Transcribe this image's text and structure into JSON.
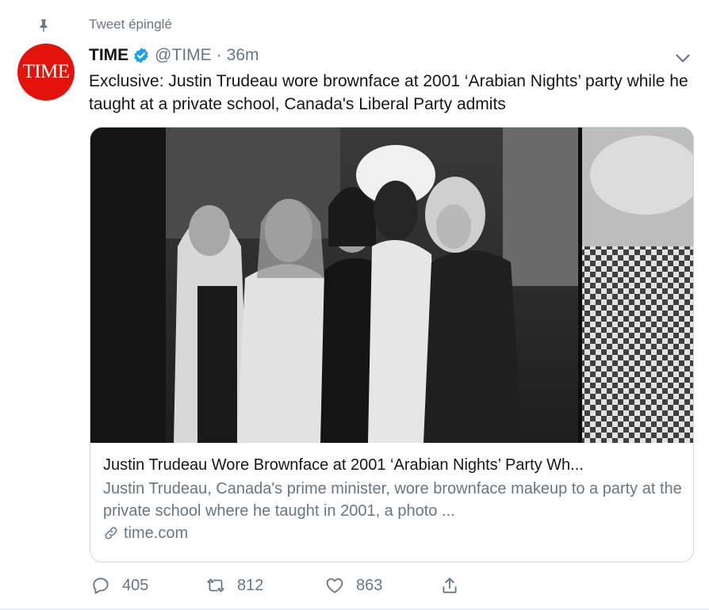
{
  "pinned": {
    "label": "Tweet épinglé"
  },
  "account": {
    "avatar_text": "TIME",
    "name": "TIME",
    "handle": "@TIME",
    "separator": "·",
    "time_ago": "36m",
    "brand_color": "#e3120b",
    "verified_color": "#1da1f2"
  },
  "tweet": {
    "text": "Exclusive: Justin Trudeau wore brownface at 2001 ‘Arabian Nights’ party while he taught at a private school, Canada's Liberal Party admits"
  },
  "card": {
    "title": "Justin Trudeau Wore Brownface at 2001 ‘Arabian Nights’ Party Wh...",
    "description": "Justin Trudeau, Canada's prime minister, wore brownface makeup to a party at the private school where he taught in 2001, a photo ...",
    "domain": "time.com",
    "image_style": "black-and-white photo"
  },
  "actions": {
    "reply_count": "405",
    "retweet_count": "812",
    "like_count": "863"
  },
  "icons": [
    "pin-icon",
    "verified-icon",
    "chevron-down-icon",
    "link-icon",
    "reply-icon",
    "retweet-icon",
    "like-icon",
    "share-icon"
  ]
}
